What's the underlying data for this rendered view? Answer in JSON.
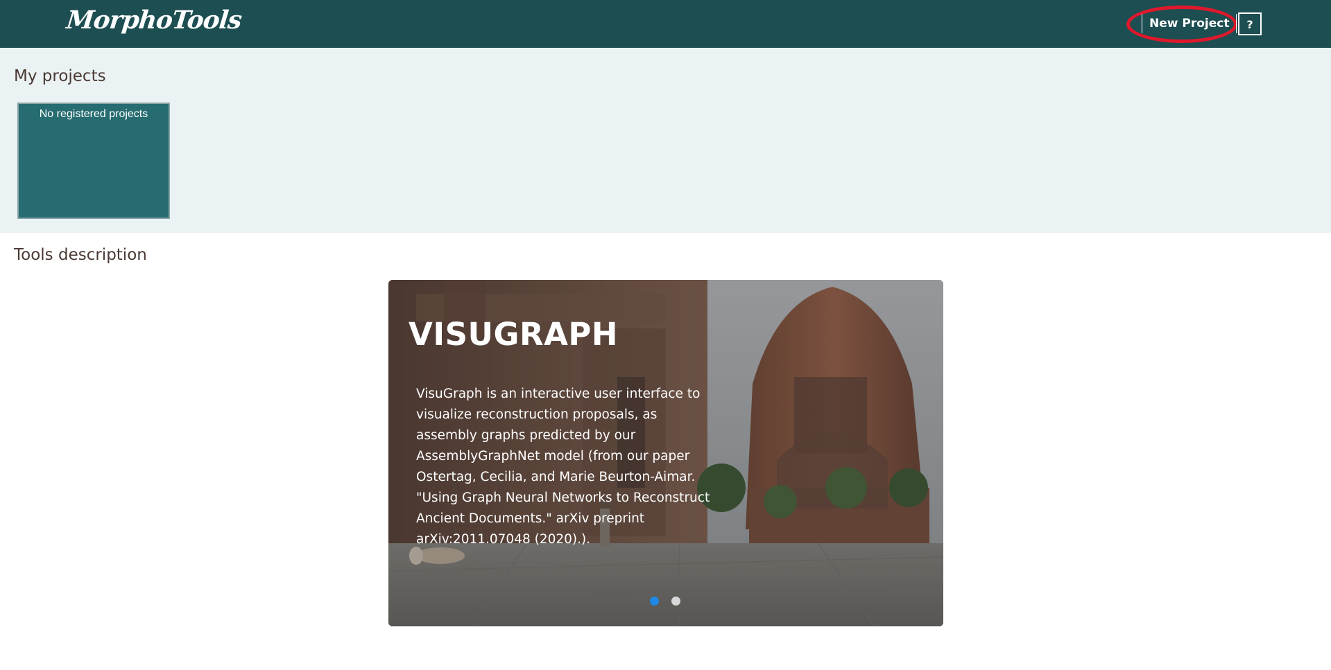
{
  "header": {
    "logo": "MorphoTools",
    "new_project_label": "New Project",
    "help_label": "?"
  },
  "projects": {
    "title": "My projects",
    "empty_text": "No registered projects"
  },
  "tools": {
    "title": "Tools description",
    "carousel": {
      "slide_title": "VISUGRAPH",
      "slide_text": "VisuGraph is an interactive user interface to visualize reconstruction proposals, as assembly graphs predicted by our AssemblyGraphNet model (from our paper Ostertag, Cecilia, and Marie Beurton-Aimar. \"Using Graph Neural Networks to Reconstruct Ancient Documents.\" arXiv preprint arXiv:2011.07048 (2020).).",
      "dots": [
        {
          "active": true
        },
        {
          "active": false
        }
      ]
    }
  },
  "colors": {
    "header_bg": "#1d4e52",
    "projects_bg": "#eaf2f3",
    "card_bg": "#266c70",
    "highlight": "#e0182c",
    "active_dot": "#1e88e5"
  }
}
